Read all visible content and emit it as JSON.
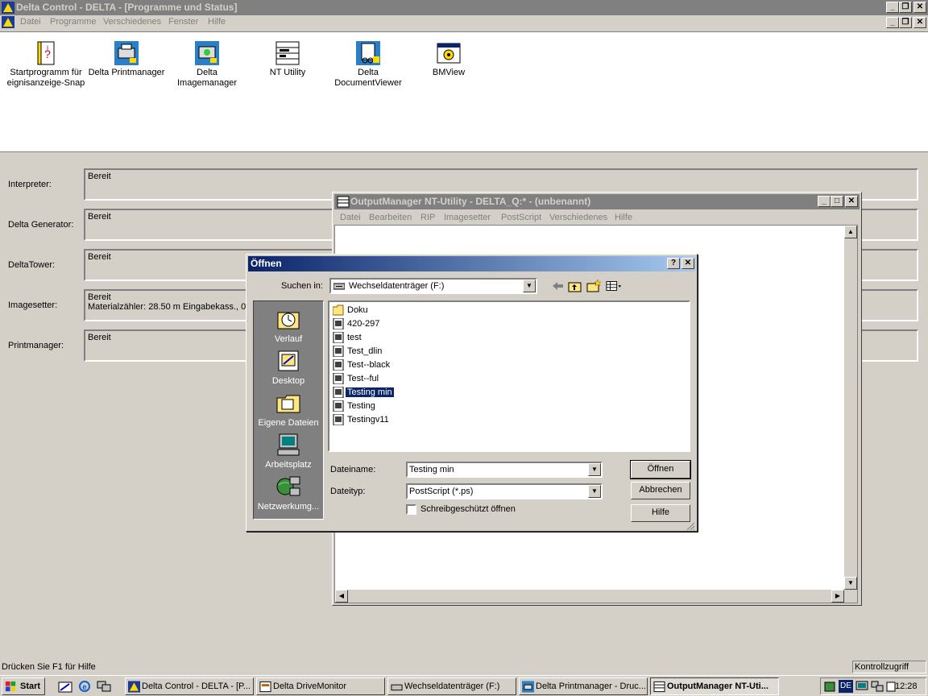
{
  "main_window": {
    "title": "Delta Control - DELTA - [Programme und Status]",
    "menu": [
      "Datei",
      "Programme",
      "Verschiedenes",
      "Fenster",
      "Hilfe"
    ]
  },
  "programs": [
    {
      "label": "Startprogramm für eignisanzeige-Snap",
      "icon": "help-document-icon"
    },
    {
      "label": "Delta Printmanager",
      "icon": "printmanager-icon"
    },
    {
      "label": "Delta Imagemanager",
      "icon": "imagemanager-icon"
    },
    {
      "label": "NT Utility",
      "icon": "nt-utility-icon"
    },
    {
      "label": "Delta DocumentViewer",
      "icon": "documentviewer-icon"
    },
    {
      "label": "BMView",
      "icon": "bmview-icon"
    }
  ],
  "status_panels": [
    {
      "label": "Interpreter:",
      "value": "Bereit",
      "detail": ""
    },
    {
      "label": "Delta Generator:",
      "value": "Bereit",
      "detail": ""
    },
    {
      "label": "DeltaTower:",
      "value": "Bereit",
      "detail": ""
    },
    {
      "label": "Imagesetter:",
      "value": "Bereit",
      "detail": "Materialzähler: 28.50 m Eingabekass., 0.0"
    },
    {
      "label": "Printmanager:",
      "value": "Bereit",
      "detail": ""
    }
  ],
  "om_window": {
    "title": "OutputManager NT-Utility - DELTA_Q:* - (unbenannt)",
    "menu": [
      "Datei",
      "Bearbeiten",
      "RIP",
      "Imagesetter",
      "PostScript",
      "Verschiedenes",
      "Hilfe"
    ]
  },
  "open_dialog": {
    "title": "Öffnen",
    "look_in_label": "Suchen in:",
    "look_in_value": "Wechseldatenträger (F:)",
    "places": [
      "Verlauf",
      "Desktop",
      "Eigene Dateien",
      "Arbeitsplatz",
      "Netzwerkumg..."
    ],
    "files": [
      {
        "name": "Doku",
        "type": "folder",
        "selected": false
      },
      {
        "name": "420-297",
        "type": "ps",
        "selected": false
      },
      {
        "name": "test",
        "type": "ps",
        "selected": false
      },
      {
        "name": "Test_dlin",
        "type": "ps",
        "selected": false
      },
      {
        "name": "Test--black",
        "type": "ps",
        "selected": false
      },
      {
        "name": "Test--ful",
        "type": "ps",
        "selected": false
      },
      {
        "name": "Testing min",
        "type": "ps",
        "selected": true
      },
      {
        "name": "Testing",
        "type": "ps",
        "selected": false
      },
      {
        "name": "Testingv11",
        "type": "ps",
        "selected": false
      }
    ],
    "filename_label": "Dateiname:",
    "filename_value": "Testing min",
    "filetype_label": "Dateityp:",
    "filetype_value": "PostScript (*.ps)",
    "readonly_label": "Schreibgeschützt öffnen",
    "readonly_checked": false,
    "open_button": "Öffnen",
    "cancel_button": "Abbrechen",
    "help_button": "Hilfe"
  },
  "statusbar": {
    "help_text": "Drücken Sie F1 für Hilfe",
    "indicator": "Kontrollzugriff"
  },
  "taskbar": {
    "start": "Start",
    "tasks": [
      {
        "label": "Delta Control - DELTA - [P...",
        "active": false
      },
      {
        "label": "Delta DriveMonitor",
        "active": false
      },
      {
        "label": "Wechseldatenträger (F:)",
        "active": false
      },
      {
        "label": "Delta Printmanager - Druc...",
        "active": false
      },
      {
        "label": "OutputManager NT-Uti...",
        "active": true
      }
    ],
    "language": "DE",
    "clock": "12:28"
  }
}
